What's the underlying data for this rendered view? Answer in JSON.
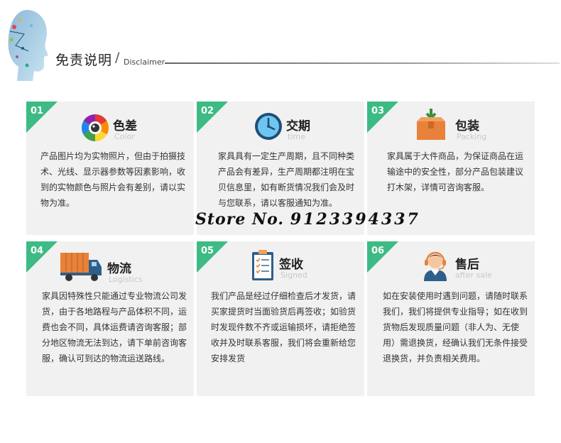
{
  "header": {
    "title": "免责说明",
    "slash": "/",
    "subtitle": "Disclaimer"
  },
  "cards": [
    {
      "num": "01",
      "title": "色差",
      "en": "Color",
      "icon": "color-wheel-icon",
      "body": "产品图片均为实物照片，但由于拍摄技术、光线、显示器参数等因素影响，收到的实物颜色与照片会有差别，请以实物为准。"
    },
    {
      "num": "02",
      "title": "交期",
      "en": "time",
      "icon": "clock-icon",
      "body": "家具具有一定生产周期，且不同种类产品会有差异，生产周期都注明在宝贝信息里，如有断货情况我们会及时与您联系，请以客服通知为准。"
    },
    {
      "num": "03",
      "title": "包装",
      "en": "Packing",
      "icon": "package-box-icon",
      "body": "家具属于大件商品，为保证商品在运输途中的安全性，部分产品包装建议打木架，详情可咨询客服。"
    },
    {
      "num": "04",
      "title": "物流",
      "en": "Logistics",
      "icon": "truck-icon",
      "body": "家具因特殊性只能通过专业物流公司发货，由于各地路程与产品体积不同，运费也会不同，具体运费请咨询客服；部分地区物流无法到达，请下单前咨询客服，确认可到达的物流运送路线。"
    },
    {
      "num": "05",
      "title": "签收",
      "en": "Signed",
      "icon": "clipboard-icon",
      "body": "我们产品是经过仔细检查后才发货，请买家提货时当面验货后再签收；如验货时发现件数不齐或运输损坏，请拒绝签收并及时联系客服，我们将会重新给您安排发货"
    },
    {
      "num": "06",
      "title": "售后",
      "en": "after sale",
      "icon": "customer-service-icon",
      "body": "如在安装使用时遇到问题，请随时联系我们，我们将提供专业指导；如在收到货物后发现质量问题（非人为、无使用）需退换货，经确认我们无条件接受退换货，并负责相关费用。"
    }
  ],
  "watermark": {
    "label": "Store No.",
    "number": "9123394337"
  },
  "colors": {
    "accent_green": "#3dbb84",
    "card_bg": "#f1f1f1"
  }
}
